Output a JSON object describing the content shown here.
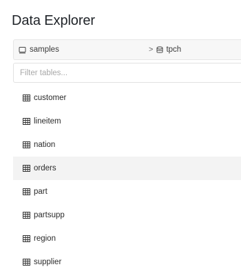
{
  "panel": {
    "title": "Data Explorer"
  },
  "catalog": {
    "name": "samples",
    "schema": "tpch",
    "separator": ">"
  },
  "filter": {
    "placeholder": "Filter tables...",
    "value": ""
  },
  "tables": [
    {
      "name": "customer",
      "selected": false
    },
    {
      "name": "lineitem",
      "selected": false
    },
    {
      "name": "nation",
      "selected": false
    },
    {
      "name": "orders",
      "selected": true
    },
    {
      "name": "part",
      "selected": false
    },
    {
      "name": "partsupp",
      "selected": false
    },
    {
      "name": "region",
      "selected": false
    },
    {
      "name": "supplier",
      "selected": false
    }
  ],
  "icons": {
    "catalog": "catalog-icon",
    "schema": "database-icon",
    "table": "table-icon"
  },
  "colors": {
    "selected_row": "#f3f3f3",
    "catalog_bar": "#f7f7f7",
    "border": "#e6e6e6"
  }
}
